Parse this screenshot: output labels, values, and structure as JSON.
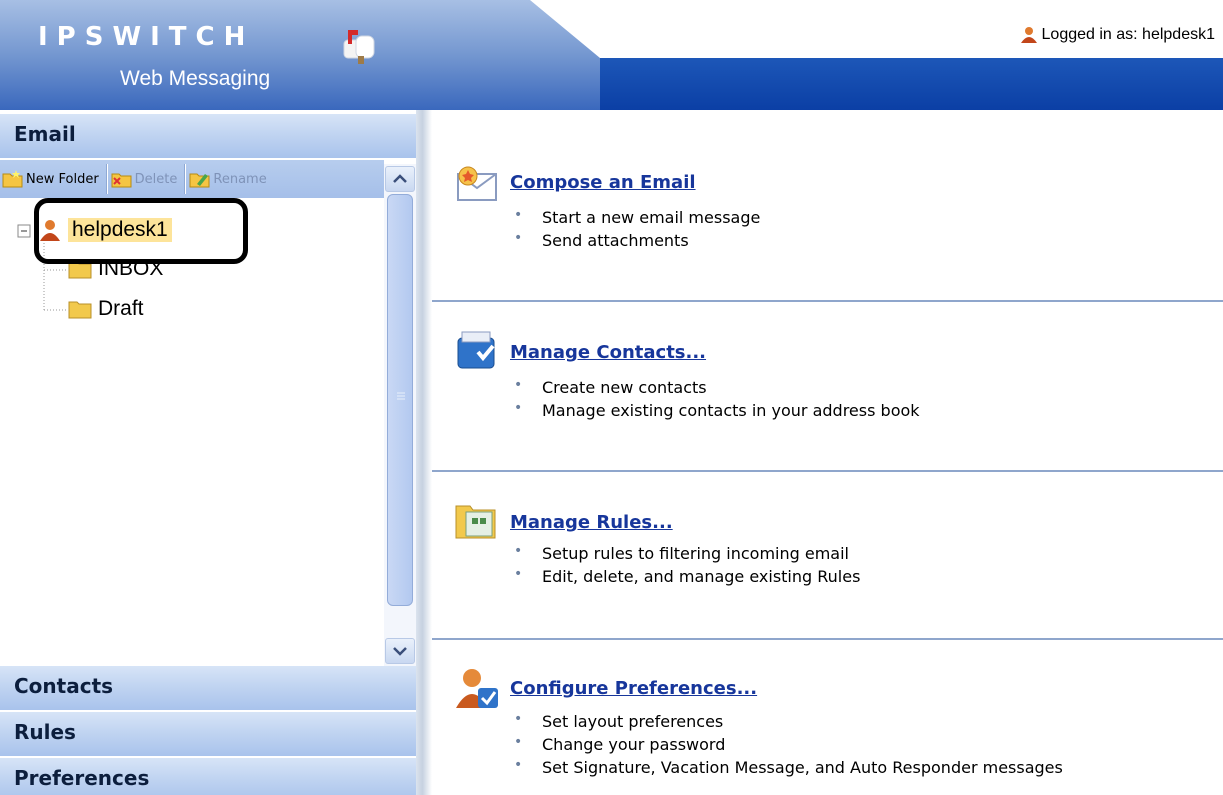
{
  "header": {
    "brand_word": "IPSWITCH",
    "brand_sub": "Web Messaging",
    "login_text": "Logged in as:  helpdesk1"
  },
  "sidebar": {
    "email_title": "Email",
    "toolbar": {
      "new_folder": "New Folder",
      "delete": "Delete",
      "rename": "Rename"
    },
    "tree": {
      "account": "helpdesk1",
      "folders": [
        "INBOX",
        "Draft"
      ]
    },
    "sections": [
      "Contacts",
      "Rules",
      "Preferences"
    ]
  },
  "main": {
    "actions": [
      {
        "title": "Compose an Email",
        "icon": "compose-email-icon",
        "bullets": [
          "Start a new email message",
          "Send attachments"
        ]
      },
      {
        "title": "Manage Contacts...",
        "icon": "contacts-icon",
        "bullets": [
          "Create new contacts",
          "Manage existing contacts in your address book"
        ]
      },
      {
        "title": "Manage Rules...",
        "icon": "rules-icon",
        "bullets": [
          "Setup rules to filtering incoming email",
          "Edit, delete, and manage existing Rules"
        ]
      },
      {
        "title": "Configure Preferences...",
        "icon": "preferences-icon",
        "bullets": [
          "Set layout preferences",
          "Change your password",
          "Set Signature, Vacation Message, and Auto Responder messages"
        ]
      }
    ]
  },
  "colors": {
    "header_blue": "#0b3fa5",
    "link_blue": "#17369b",
    "section_blue": "#bcd1f0",
    "highlight": "#fde49a"
  }
}
